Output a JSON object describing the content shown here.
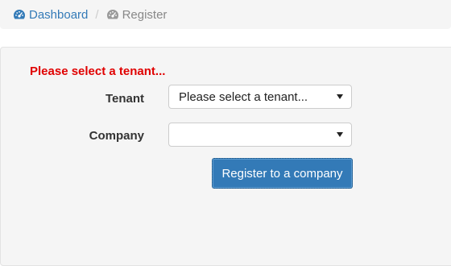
{
  "breadcrumb": {
    "items": [
      {
        "label": "Dashboard",
        "icon": "dashboard-icon",
        "active": false
      },
      {
        "label": "Register",
        "icon": "dashboard-icon",
        "active": true
      }
    ],
    "separator": "/"
  },
  "form": {
    "error_message": "Please select a tenant...",
    "tenant_label": "Tenant",
    "tenant_value": "Please select a tenant...",
    "company_label": "Company",
    "company_value": "",
    "submit_label": "Register to a company"
  },
  "colors": {
    "link": "#337ab7",
    "error": "#e00000",
    "primary_button": "#337ab7"
  }
}
